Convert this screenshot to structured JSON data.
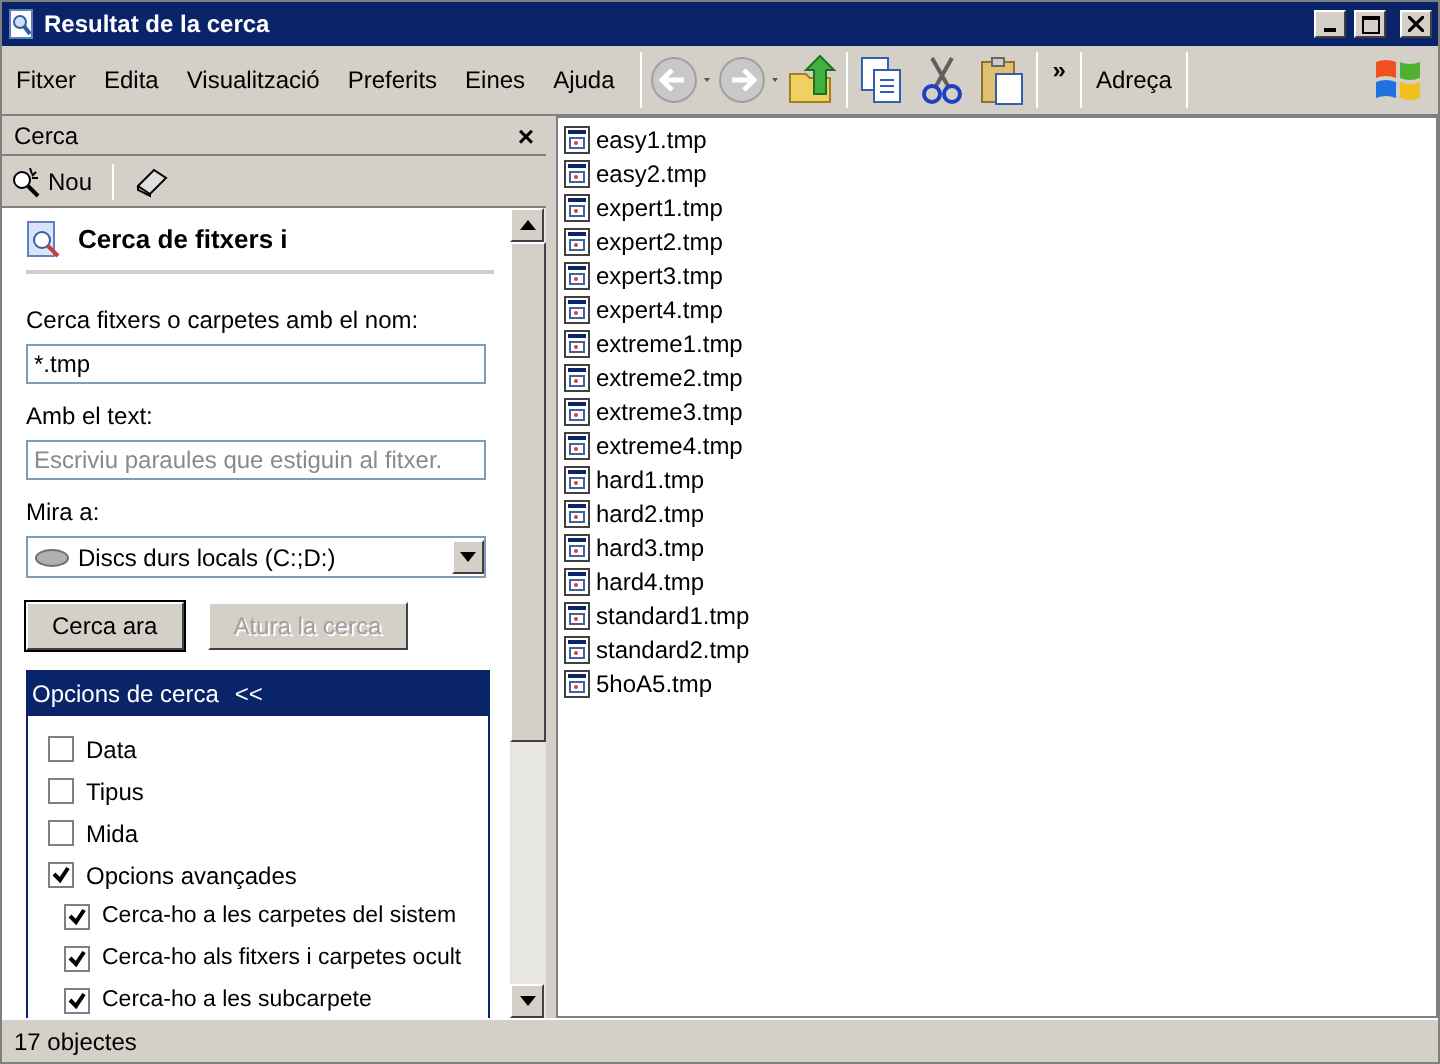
{
  "window": {
    "title": "Resultat de la cerca"
  },
  "menu": [
    "Fitxer",
    "Edita",
    "Visualització",
    "Preferits",
    "Eines",
    "Ajuda"
  ],
  "toolbar": {
    "overflow": "»",
    "address_label": "Adreça"
  },
  "search_pane": {
    "title": "Cerca",
    "close": "×",
    "new_label": "Nou",
    "heading": "Cerca de fitxers i",
    "name_label": "Cerca fitxers o carpetes amb el nom:",
    "name_value": "*.tmp",
    "text_label": "Amb el text:",
    "text_placeholder": "Escriviu paraules que estiguin al fitxer.",
    "look_in_label": "Mira a:",
    "look_in_value": "Discs durs locals (C:;D:)",
    "buttons": [
      {
        "label": "Cerca ara",
        "disabled": false
      },
      {
        "label": "Atura la cerca",
        "disabled": true
      }
    ],
    "options_header": "Opcions de cerca",
    "options_toggle": "<<",
    "options": [
      {
        "label": "Data",
        "checked": false
      },
      {
        "label": "Tipus",
        "checked": false
      },
      {
        "label": "Mida",
        "checked": false
      },
      {
        "label": "Opcions avançades",
        "checked": true,
        "children": [
          {
            "label": "Cerca-ho a les carpetes del sistem",
            "checked": true
          },
          {
            "label": "Cerca-ho als fitxers i carpetes ocult",
            "checked": true
          },
          {
            "label": "Cerca-ho a les subcarpete",
            "checked": true
          }
        ]
      }
    ]
  },
  "files": [
    "easy1.tmp",
    "easy2.tmp",
    "expert1.tmp",
    "expert2.tmp",
    "expert3.tmp",
    "expert4.tmp",
    "extreme1.tmp",
    "extreme2.tmp",
    "extreme3.tmp",
    "extreme4.tmp",
    "hard1.tmp",
    "hard2.tmp",
    "hard3.tmp",
    "hard4.tmp",
    "standard1.tmp",
    "standard2.tmp",
    "5hoA5.tmp"
  ],
  "status_bar": "17 objectes"
}
